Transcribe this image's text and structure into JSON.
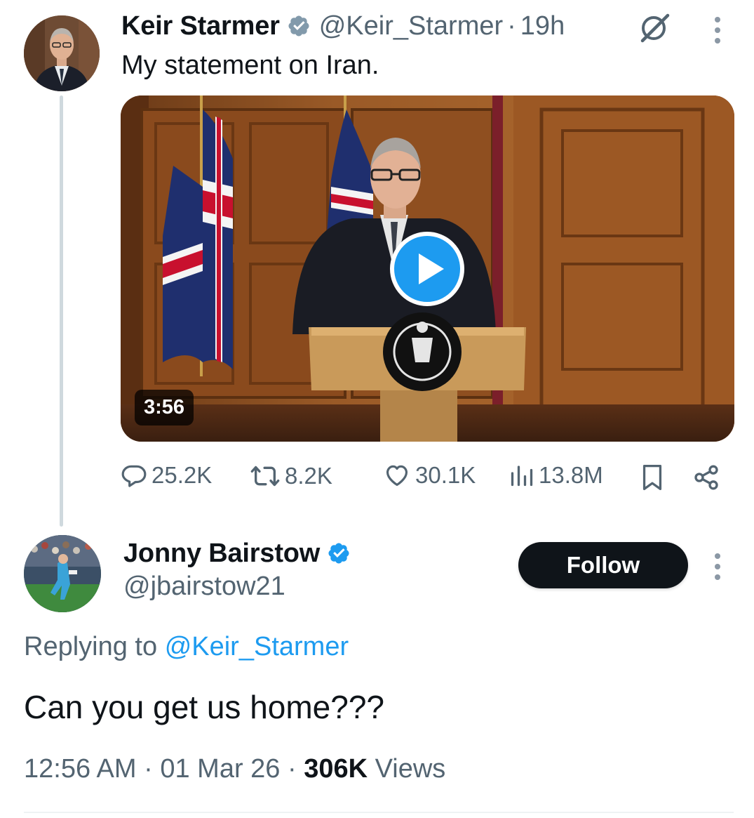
{
  "tweet": {
    "author_name": "Keir Starmer",
    "handle": "@Keir_Starmer",
    "separator": "·",
    "time_ago": "19h",
    "text": "My statement on Iran.",
    "video": {
      "duration": "3:56"
    },
    "actions": {
      "replies": "25.2K",
      "reposts": "8.2K",
      "likes": "30.1K",
      "views": "13.8M"
    },
    "icons": [
      "verified-badge-icon",
      "grok-icon",
      "more-icon",
      "play-icon",
      "reply-icon",
      "repost-icon",
      "like-icon",
      "views-icon",
      "bookmark-icon",
      "share-icon"
    ]
  },
  "reply": {
    "author_name": "Jonny Bairstow",
    "handle": "@jbairstow21",
    "follow_label": "Follow",
    "replying_prefix": "Replying to",
    "replying_handle": "@Keir_Starmer",
    "text": "Can you get us home???",
    "time": "12:56 AM",
    "date": "01 Mar 26",
    "separator": "·",
    "views_count": "306K",
    "views_label": "Views"
  },
  "colors": {
    "text_primary": "#0f1419",
    "text_secondary": "#536471",
    "accent_blue": "#1d9bf0",
    "verified_gray": "#829aab",
    "follow_button_bg": "#0f1419",
    "thread_line": "#cfd9de"
  }
}
